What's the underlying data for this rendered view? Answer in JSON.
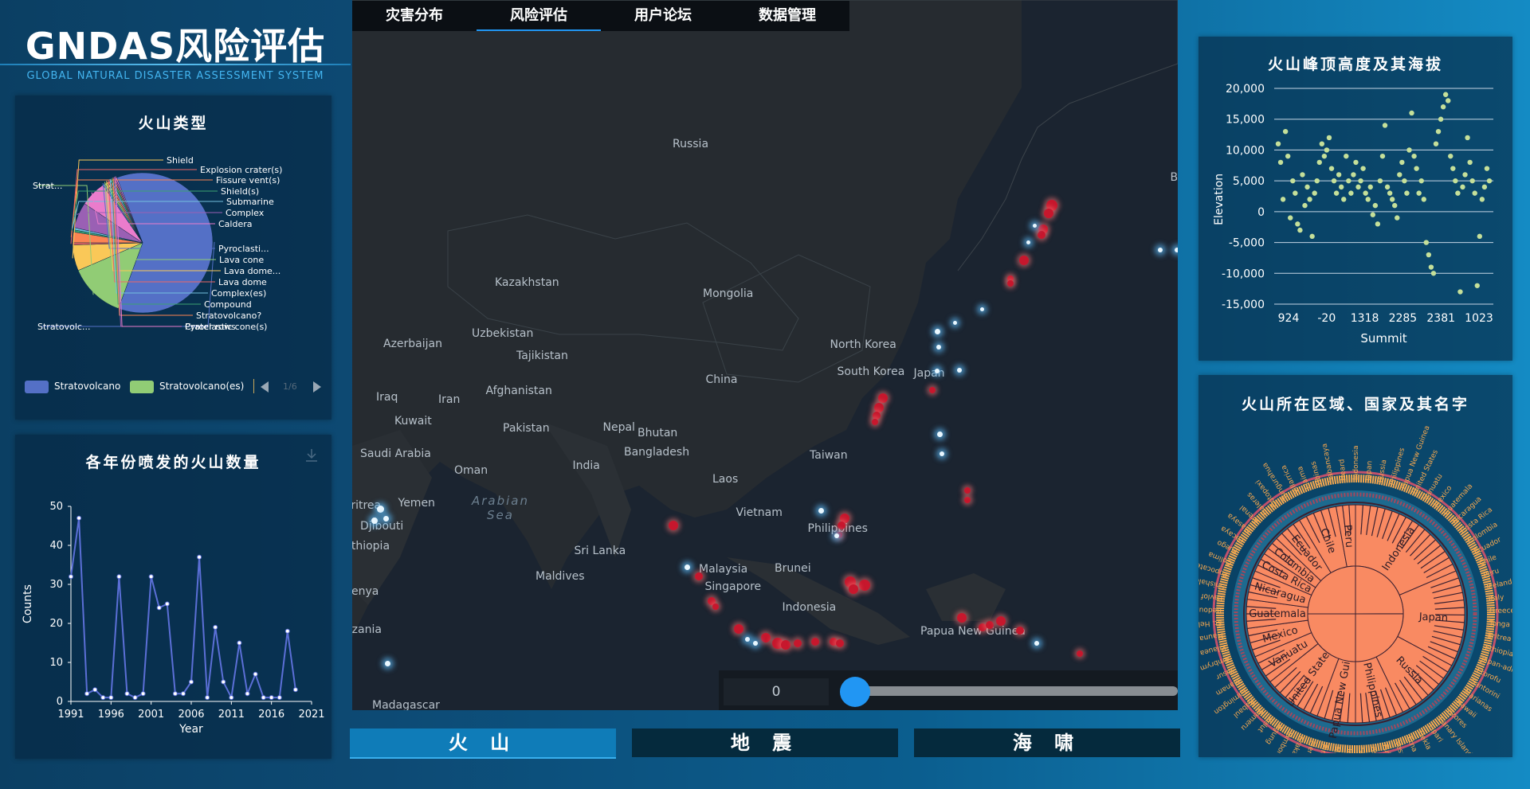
{
  "header": {
    "title": "GNDAS风险评估",
    "subtitle": "GLOBAL NATURAL DISASTER ASSESSMENT SYSTEM"
  },
  "tabs": [
    "灾害分布",
    "风险评估",
    "用户论坛",
    "数据管理"
  ],
  "active_tab": 1,
  "map": {
    "countries": [
      {
        "name": "Russia",
        "x": 865,
        "y": 182
      },
      {
        "name": "Kazakhstan",
        "x": 656,
        "y": 356
      },
      {
        "name": "Mongolia",
        "x": 910,
        "y": 370
      },
      {
        "name": "Uzbekistan",
        "x": 627,
        "y": 420
      },
      {
        "name": "Tajikistan",
        "x": 683,
        "y": 448
      },
      {
        "name": "Azerbaijan",
        "x": 516,
        "y": 433
      },
      {
        "name": "Iraq",
        "x": 486,
        "y": 500
      },
      {
        "name": "Iran",
        "x": 564,
        "y": 503
      },
      {
        "name": "Afghanistan",
        "x": 648,
        "y": 492
      },
      {
        "name": "Pakistan",
        "x": 659,
        "y": 539
      },
      {
        "name": "Kuwait",
        "x": 516,
        "y": 530
      },
      {
        "name": "Saudi Arabia",
        "x": 494,
        "y": 571
      },
      {
        "name": "Oman",
        "x": 584,
        "y": 592
      },
      {
        "name": "Yemen",
        "x": 517,
        "y": 633
      },
      {
        "name": "Eritrea",
        "x": 456,
        "y": 636
      },
      {
        "name": "Djibouti",
        "x": 480,
        "y": 662
      },
      {
        "name": "Ethiopia",
        "x": 460,
        "y": 687
      },
      {
        "name": "Kenya",
        "x": 450,
        "y": 744
      },
      {
        "name": "Tanzania",
        "x": 446,
        "y": 792
      },
      {
        "name": "Madagascar",
        "x": 502,
        "y": 887
      },
      {
        "name": "Nepal",
        "x": 774,
        "y": 538
      },
      {
        "name": "Bhutan",
        "x": 821,
        "y": 545
      },
      {
        "name": "Bangladesh",
        "x": 818,
        "y": 569
      },
      {
        "name": "India",
        "x": 736,
        "y": 586
      },
      {
        "name": "China",
        "x": 903,
        "y": 478
      },
      {
        "name": "North Korea",
        "x": 1080,
        "y": 434
      },
      {
        "name": "South Korea",
        "x": 1089,
        "y": 468
      },
      {
        "name": "Japan",
        "x": 1164,
        "y": 470
      },
      {
        "name": "Taiwan",
        "x": 1037,
        "y": 573
      },
      {
        "name": "Laos",
        "x": 908,
        "y": 603
      },
      {
        "name": "Vietnam",
        "x": 948,
        "y": 645
      },
      {
        "name": "Philippines",
        "x": 1052,
        "y": 665
      },
      {
        "name": "Sri Lanka",
        "x": 752,
        "y": 693
      },
      {
        "name": "Maldives",
        "x": 700,
        "y": 725
      },
      {
        "name": "Malaysia",
        "x": 905,
        "y": 716
      },
      {
        "name": "Brunei",
        "x": 993,
        "y": 715
      },
      {
        "name": "Singapore",
        "x": 916,
        "y": 738
      },
      {
        "name": "Indonesia",
        "x": 1013,
        "y": 764
      },
      {
        "name": "Papua New Guinea",
        "x": 1211,
        "y": 794
      },
      {
        "name": "B",
        "x": 1472,
        "y": 224
      }
    ],
    "seas": [
      {
        "name": "Arabian Sea",
        "x": 628,
        "y": 640
      }
    ],
    "slider_value": "0"
  },
  "pie_panel": {
    "title": "火山类型",
    "labels": [
      "Shield",
      "Explosion crater(s)",
      "Fissure vent(s)",
      "Shield(s)",
      "Submarine",
      "Complex",
      "Caldera",
      "Pyroclasti...",
      "Lava cone",
      "Lava dome...",
      "Lava dome",
      "Complex(es)",
      "Compound",
      "Stratovolcano?",
      "Pyroclastic cone(s)",
      "Crater rows",
      "Stratovolc...",
      "Strat..."
    ],
    "legend": [
      "Stratovolcano",
      "Stratovolcano(es)"
    ],
    "legend_page": "1/6"
  },
  "line_panel": {
    "title": "各年份喷发的火山数量"
  },
  "scatter_panel": {
    "title": "火山峰顶高度及其海拔"
  },
  "sunburst_panel": {
    "title": "火山所在区域、国家及其名字",
    "labels": [
      "Indonesia",
      "Japan",
      "Russia",
      "Philippines",
      "Papua New Guinea",
      "United States",
      "Vanuatu",
      "Mexico",
      "Guatemala",
      "Nicaragua",
      "Costa Rica",
      "Colombia",
      "Ecuador",
      "Chile",
      "Peru",
      "Iceland",
      "Italy",
      "Greece",
      "Tonga",
      "Eritrea",
      "Ethiopia",
      "Japan-administered Russia",
      "Etorofu",
      "Santorini",
      "Marianas",
      "Hawaii",
      "Azores",
      "Canary Islands",
      "Lipari",
      "Hekla",
      "Etna",
      "Vesuvius",
      "Fuji",
      "Aso",
      "Sakura-jima",
      "Taal",
      "Mayon",
      "Pinatubo",
      "Merapi",
      "Krakatau",
      "Tambora",
      "Agung",
      "Kelut",
      "Semeru",
      "Rabaul",
      "Lamington",
      "Manam",
      "Yasur",
      "Ambrym",
      "Kilauea",
      "Mauna Loa",
      "St. Helens",
      "Redoubt",
      "Pavlof",
      "Shishaldin",
      "Popocatepetl",
      "Colima",
      "Fuego",
      "Pacaya",
      "Masaya",
      "Arenal",
      "Galeras",
      "Cotopaxi",
      "Tungurahua",
      "Villarrica",
      "Llaima",
      "Ubinas",
      "Sabancaya",
      "Heard"
    ],
    "sunburst_labels": [
      "Indonesia",
      "Japan",
      "Russia",
      "Philippines",
      "Papua New Guinea",
      "United States",
      "Vanuatu",
      "Mexico",
      "Guatemala",
      "Nicaragua",
      "Costa Rica",
      "Colombia",
      "Ecuador",
      "Chile",
      "Peru",
      "Iceland",
      "Italy",
      "Greece",
      "Tonga",
      "Eritrea",
      "Ethiopia",
      "Japan-administered Russia",
      "Etorofu",
      "Santorini",
      "Marianas",
      "Hawaii",
      "Azores",
      "Canary Islands",
      "Lipari",
      "Hekla",
      "Etna",
      "Vesuvius",
      "Fuji",
      "Aso",
      "Sakura-jima",
      "Taal",
      "Mayon",
      "Pinatubo",
      "Merapi",
      "Krakatau",
      "Tambora",
      "Agung",
      "Kelut",
      "Semeru",
      "Rabaul",
      "Lamington",
      "Manam",
      "Yasur",
      "Ambrym",
      "Kilauea",
      "Mauna Loa",
      "St. Helens",
      "Redoubt",
      "Pavlof",
      "Shishaldin",
      "Popocatepetl",
      "Colima",
      "Fuego",
      "Pacaya",
      "Masaya",
      "Arenal",
      "Galeras",
      "Cotopaxi",
      "Tungurahua",
      "Villarrica",
      "Llaima",
      "Ubinas",
      "Sabancaya",
      "Heard"
    ]
  },
  "bottom_buttons": [
    "火 山",
    "地 震",
    "海 啸"
  ],
  "colors": {
    "accent": "#2196f3",
    "hot": "#c7172d",
    "line": "#5b6fd6",
    "scatter": "#c5e09a",
    "sunburst": "#f98a62"
  },
  "chart_data": [
    {
      "type": "pie",
      "title": "火山类型",
      "slices": [
        {
          "label": "Stratovolc...",
          "value": 62,
          "color": "#5470c6"
        },
        {
          "label": "Strat...",
          "value": 13,
          "color": "#91cc75"
        },
        {
          "label": "Shield",
          "value": 6,
          "color": "#fac858"
        },
        {
          "label": "Explosion crater(s)",
          "value": 0.5,
          "color": "#ee6666"
        },
        {
          "label": "Fissure vent(s)",
          "value": 2.5,
          "color": "#fc8452"
        },
        {
          "label": "Shield(s)",
          "value": 0.5,
          "color": "#3ba272"
        },
        {
          "label": "Submarine",
          "value": 0.5,
          "color": "#73c0de"
        },
        {
          "label": "Complex",
          "value": 6,
          "color": "#9a60b4"
        },
        {
          "label": "Caldera",
          "value": 6,
          "color": "#ea7ccc"
        },
        {
          "label": "Pyroclasti...",
          "value": 0.5,
          "color": "#5470c6"
        },
        {
          "label": "Lava cone",
          "value": 0.5,
          "color": "#91cc75"
        },
        {
          "label": "Lava dome...",
          "value": 0.4,
          "color": "#fac858"
        },
        {
          "label": "Lava dome",
          "value": 0.5,
          "color": "#ee6666"
        },
        {
          "label": "Complex(es)",
          "value": 0.4,
          "color": "#73c0de"
        },
        {
          "label": "Compound",
          "value": 0.4,
          "color": "#3ba272"
        },
        {
          "label": "Stratovolcano?",
          "value": 0.3,
          "color": "#fc8452"
        },
        {
          "label": "Pyroclastic cone(s)",
          "value": 0.3,
          "color": "#9a60b4"
        },
        {
          "label": "Crater rows",
          "value": 0.3,
          "color": "#ea7ccc"
        }
      ],
      "legend": [
        "Stratovolcano",
        "Stratovolcano(es)"
      ]
    },
    {
      "type": "line",
      "title": "各年份喷发的火山数量",
      "xlabel": "Year",
      "ylabel": "Counts",
      "xlim": [
        1991,
        2021
      ],
      "ylim": [
        0,
        50
      ],
      "xticks": [
        1991,
        1996,
        2001,
        2006,
        2011,
        2016,
        2021
      ],
      "yticks": [
        0,
        10,
        20,
        30,
        40,
        50
      ],
      "x": [
        1991,
        1992,
        1993,
        1994,
        1995,
        1996,
        1997,
        1998,
        1999,
        2000,
        2001,
        2002,
        2003,
        2004,
        2005,
        2006,
        2007,
        2008,
        2009,
        2010,
        2011,
        2012,
        2013,
        2014,
        2015,
        2016,
        2017,
        2018,
        2019
      ],
      "y": [
        32,
        47,
        2,
        3,
        1,
        1,
        32,
        2,
        1,
        2,
        32,
        24,
        25,
        2,
        2,
        5,
        37,
        1,
        19,
        5,
        1,
        15,
        2,
        7,
        1,
        1,
        1,
        18,
        3
      ]
    },
    {
      "type": "scatter",
      "title": "火山峰顶高度及其海拔",
      "xlabel": "Summit",
      "ylabel": "Elevation",
      "ylim": [
        -15000,
        20000
      ],
      "yticks": [
        -15000,
        -10000,
        -5000,
        0,
        5000,
        10000,
        15000,
        20000
      ],
      "xtick_labels": [
        "924",
        "-20",
        "1318",
        "2285",
        "2381",
        "1023"
      ],
      "y": [
        11000,
        8000,
        2000,
        13000,
        9000,
        -1000,
        5000,
        3000,
        -2000,
        -3000,
        6000,
        1000,
        4000,
        2000,
        -4000,
        3000,
        5000,
        8000,
        11000,
        9000,
        10000,
        12000,
        7000,
        5000,
        3000,
        6000,
        4000,
        2000,
        9000,
        5000,
        3000,
        6000,
        8000,
        4000,
        5000,
        7000,
        3000,
        2000,
        4000,
        -500,
        1000,
        -2000,
        5000,
        9000,
        14000,
        4000,
        3000,
        2000,
        1000,
        -1000,
        6000,
        8000,
        5000,
        3000,
        10000,
        16000,
        9000,
        7000,
        3000,
        5000,
        2000,
        -5000,
        -7000,
        -9000,
        -10000,
        11000,
        13000,
        15000,
        17000,
        19000,
        18000,
        9000,
        7000,
        5000,
        3000,
        -13000,
        4000,
        6000,
        12000,
        8000,
        5000,
        3000,
        -12000,
        -4000,
        2000,
        4000,
        7000,
        5000
      ]
    },
    {
      "type": "sunburst",
      "title": "火山所在区域、国家及其名字",
      "inner": [
        {
          "label": "Indonesia",
          "value": 13
        },
        {
          "label": "Japan",
          "value": 10
        },
        {
          "label": "Russia",
          "value": 7
        },
        {
          "label": "Philippines",
          "value": 5
        },
        {
          "label": "Papua New Guinea",
          "value": 4
        },
        {
          "label": "United States",
          "value": 6
        },
        {
          "label": "Vanuatu",
          "value": 3
        },
        {
          "label": "Mexico",
          "value": 3
        },
        {
          "label": "Guatemala",
          "value": 3
        },
        {
          "label": "Nicaragua",
          "value": 3
        },
        {
          "label": "Costa Rica",
          "value": 2
        },
        {
          "label": "Colombia",
          "value": 2
        },
        {
          "label": "Ecuador",
          "value": 3
        },
        {
          "label": "Chile",
          "value": 4
        },
        {
          "label": "Peru",
          "value": 2
        }
      ]
    }
  ]
}
